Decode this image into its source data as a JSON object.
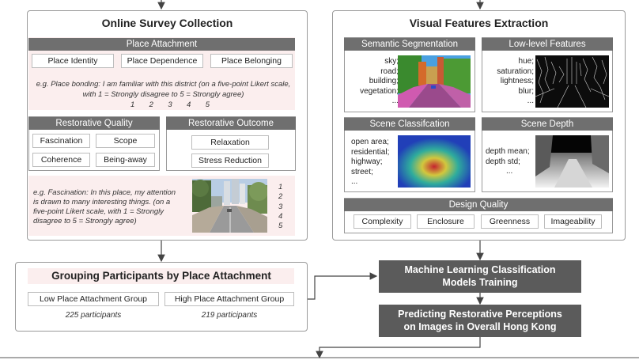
{
  "survey": {
    "title": "Online Survey Collection",
    "attachment": {
      "header": "Place Attachment",
      "items": [
        "Place Identity",
        "Place Dependence",
        "Place Belonging"
      ],
      "example_line1": "e.g. Place bonding: I am familiar with this district (on a five-point Likert scale,",
      "example_line2": "with 1 = Strongly disagree to 5 = Strongly agree)",
      "scale": [
        "1",
        "2",
        "3",
        "4",
        "5"
      ]
    },
    "restorative_quality": {
      "header": "Restorative Quality",
      "items": [
        "Fascination",
        "Scope",
        "Coherence",
        "Being-away"
      ]
    },
    "restorative_outcome": {
      "header": "Restorative Outcome",
      "items": [
        "Relaxation",
        "Stress Reduction"
      ]
    },
    "fascination_example": {
      "line1": "e.g. Fascination: In this place, my attention",
      "line2": "is drawn to many interesting things. (on a",
      "line3": "five-point Likert scale, with 1 = Strongly",
      "line4": "disagree to 5 = Strongly agree)",
      "scale": [
        "1",
        "2",
        "3",
        "4",
        "5"
      ]
    }
  },
  "grouping": {
    "title": "Grouping Participants by Place Attachment",
    "groups": [
      {
        "label": "Low Place Attachment Group",
        "count": "225 participants"
      },
      {
        "label": "High Place Attachment Group",
        "count": "219 participants"
      }
    ]
  },
  "features": {
    "title": "Visual Features Extraction",
    "semantic": {
      "header": "Semantic Segmentation",
      "lines": [
        "sky;",
        "road;",
        "building;",
        "vegetation;",
        "..."
      ]
    },
    "lowlevel": {
      "header": "Low-level Features",
      "lines": [
        "hue;",
        "saturation;",
        "lightness;",
        "blur;",
        "..."
      ]
    },
    "scene_class": {
      "header": "Scene Classifcation",
      "lines": [
        "open area;",
        "residential;",
        "highway;",
        "street;",
        "..."
      ]
    },
    "scene_depth": {
      "header": "Scene Depth",
      "lines": [
        "depth mean;",
        "depth std;",
        "..."
      ]
    },
    "design": {
      "header": "Design Quality",
      "items": [
        "Complexity",
        "Enclosure",
        "Greenness",
        "Imageability"
      ]
    }
  },
  "steps": {
    "ml_line1": "Machine Learning Classification",
    "ml_line2": "Models Training",
    "pred_line1": "Predicting Restorative Perceptions",
    "pred_line2": "on Images in Overall Hong Kong"
  }
}
